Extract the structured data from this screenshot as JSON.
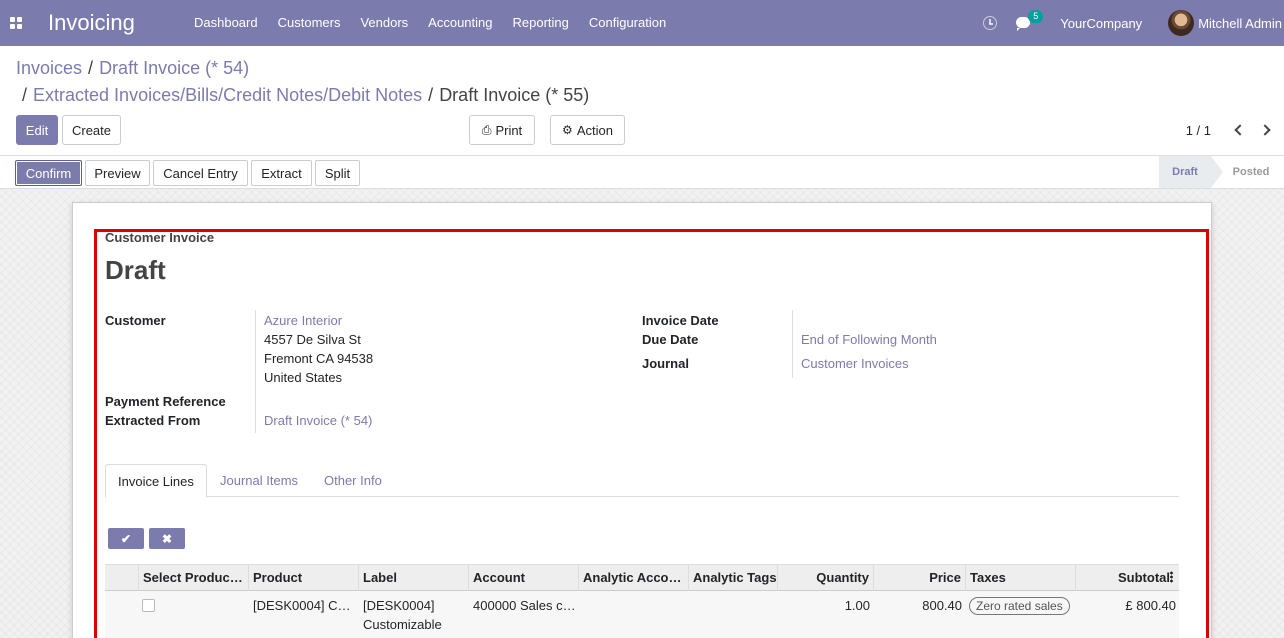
{
  "navbar": {
    "app_name": "Invoicing",
    "menu": [
      "Dashboard",
      "Customers",
      "Vendors",
      "Accounting",
      "Reporting",
      "Configuration"
    ],
    "chat_count": "5",
    "company": "YourCompany",
    "user": "Mitchell Admin"
  },
  "breadcrumb": {
    "line1": [
      "Invoices",
      "Draft Invoice (* 54)"
    ],
    "line2": [
      "Extracted Invoices/Bills/Credit Notes/Debit Notes",
      "Draft Invoice (* 55)"
    ],
    "separator": "/"
  },
  "controls": {
    "edit": "Edit",
    "create": "Create",
    "print": "Print",
    "action": "Action",
    "pager": "1 / 1"
  },
  "statusbar": {
    "buttons": [
      "Confirm",
      "Preview",
      "Cancel Entry",
      "Extract",
      "Split"
    ],
    "stages": [
      "Draft",
      "Posted"
    ],
    "active_stage": "Draft"
  },
  "form": {
    "doc_type": "Customer Invoice",
    "title": "Draft",
    "labels": {
      "customer": "Customer",
      "payment_reference": "Payment Reference",
      "extracted_from": "Extracted From",
      "invoice_date": "Invoice Date",
      "due_date": "Due Date",
      "journal": "Journal"
    },
    "customer_name": "Azure Interior",
    "customer_address": [
      "4557 De Silva St",
      "Fremont CA 94538",
      "United States"
    ],
    "extracted_from_value": "Draft Invoice (* 54)",
    "invoice_date_value": "",
    "due_date_value": "End of Following Month",
    "journal_value": "Customer Invoices"
  },
  "tabs": [
    "Invoice Lines",
    "Journal Items",
    "Other Info"
  ],
  "table": {
    "columns": [
      "Select Produc…",
      "Product",
      "Label",
      "Account",
      "Analytic Acco…",
      "Analytic Tags",
      "Quantity",
      "Price",
      "Taxes",
      "Subtotal"
    ],
    "rows": [
      {
        "product": "[DESK0004] C…",
        "label_line1": "[DESK0004]",
        "label_line2": "Customizable",
        "account": "400000 Sales c…",
        "analytic_account": "",
        "analytic_tags": "",
        "quantity": "1.00",
        "price": "800.40",
        "taxes": "Zero rated sales",
        "subtotal": "£ 800.40"
      }
    ]
  },
  "colors": {
    "brand": "#7c7bad",
    "highlight_border": "#e00000"
  }
}
